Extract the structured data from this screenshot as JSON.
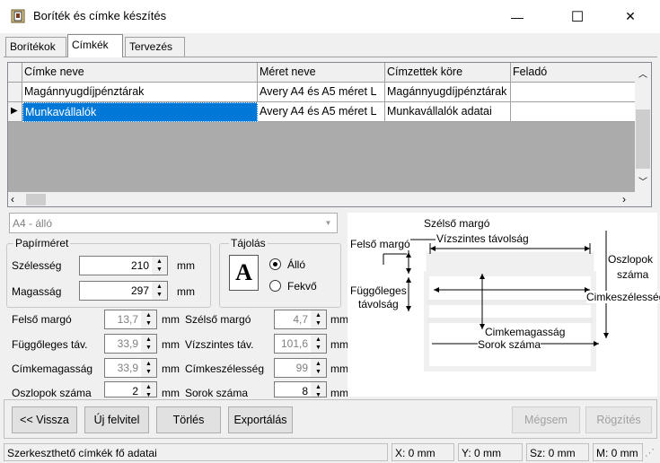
{
  "window": {
    "title": "Boríték és címke készítés",
    "minimize": "—",
    "maximize": "☐",
    "close": "✕"
  },
  "tabs": [
    {
      "label": "Borítékok"
    },
    {
      "label": "Címkék"
    },
    {
      "label": "Tervezés"
    }
  ],
  "grid": {
    "columns": [
      "Címke neve",
      "Méret neve",
      "Címzettek köre",
      "Feladó"
    ],
    "rows": [
      [
        "Magánnyugdíjpénztárak",
        "Avery A4 és A5 méret L",
        "Magánnyugdíjpénztárak",
        ""
      ],
      [
        "Munkavállalók",
        "Avery A4 és A5 méret L",
        "Munkavállalók adatai",
        ""
      ]
    ],
    "selected_row": 1,
    "current_indicator": "▶"
  },
  "paper_select": {
    "value": "A4 - álló"
  },
  "papirmeret": {
    "legend": "Papírméret",
    "width_label": "Szélesség",
    "width_value": "210",
    "width_unit": "mm",
    "height_label": "Magasság",
    "height_value": "297",
    "height_unit": "mm"
  },
  "tajolas": {
    "legend": "Tájolás",
    "icon_letter": "A",
    "option_allo": "Álló",
    "option_fekvo": "Fekvő",
    "selected": "Álló"
  },
  "params": {
    "felso_margo": {
      "label": "Felső margó",
      "value": "13,7",
      "unit": "mm"
    },
    "fuggoleges_tav": {
      "label": "Függőleges táv.",
      "value": "33,9",
      "unit": "mm"
    },
    "cimkemagassag": {
      "label": "Címkemagasság",
      "value": "33,9",
      "unit": "mm"
    },
    "oszlopok_szama": {
      "label": "Oszlopok száma",
      "value": "2",
      "unit": "mm"
    },
    "szelso_margo": {
      "label": "Szélső margó",
      "value": "4,7",
      "unit": "mm"
    },
    "vizszintes_tav": {
      "label": "Vízszintes táv.",
      "value": "101,6",
      "unit": "mm"
    },
    "cimkeszelesseg": {
      "label": "Címkeszélesség",
      "value": "99",
      "unit": "mm"
    },
    "sorok_szama": {
      "label": "Sorok száma",
      "value": "8",
      "unit": "mm"
    }
  },
  "preview": {
    "szelso_margo": "Szélső margó",
    "felso_margo": "Felső margó",
    "vizszintes_tavolsag": "Vízszintes távolság",
    "oszlopok_1": "Oszlopok",
    "oszlopok_2": "száma",
    "fuggoleges_1": "Függőleges",
    "fuggoleges_2": "távolság",
    "cimkeszelesseg": "Cimkeszélesség",
    "cimkemagassag": "Cimkemagasság",
    "sorok_szama": "Sorok száma"
  },
  "buttons": {
    "vissza": "<< Vissza",
    "uj_felvitel": "Új felvitel",
    "torles": "Törlés",
    "exportalas": "Exportálás",
    "megsem": "Mégsem",
    "rogzites": "Rögzítés"
  },
  "status": {
    "message": "Szerkeszthető címkék fő adatai",
    "x": "X: 0 mm",
    "y": "Y: 0 mm",
    "sz": "Sz: 0 mm",
    "m": "M: 0 mm"
  }
}
